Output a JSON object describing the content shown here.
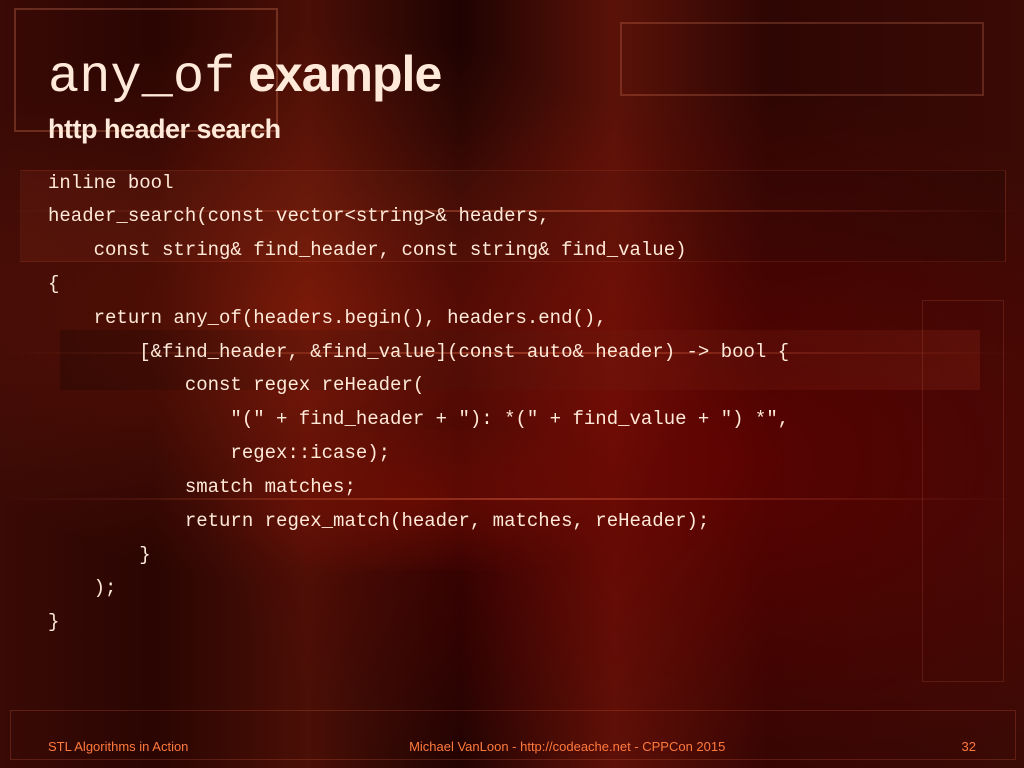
{
  "title": {
    "mono": "any_of",
    "rest": " example"
  },
  "subtitle": "http header search",
  "code": "inline bool\nheader_search(const vector<string>& headers,\n    const string& find_header, const string& find_value)\n{\n    return any_of(headers.begin(), headers.end(),\n        [&find_header, &find_value](const auto& header) -> bool {\n            const regex reHeader(\n                \"(\" + find_header + \"): *(\" + find_value + \") *\",\n                regex::icase);\n            smatch matches;\n            return regex_match(header, matches, reHeader);\n        }\n    );\n}",
  "footer": {
    "left": "STL Algorithms in Action",
    "center": "Michael VanLoon - http://codeache.net - CPPCon 2015",
    "page": "32"
  }
}
